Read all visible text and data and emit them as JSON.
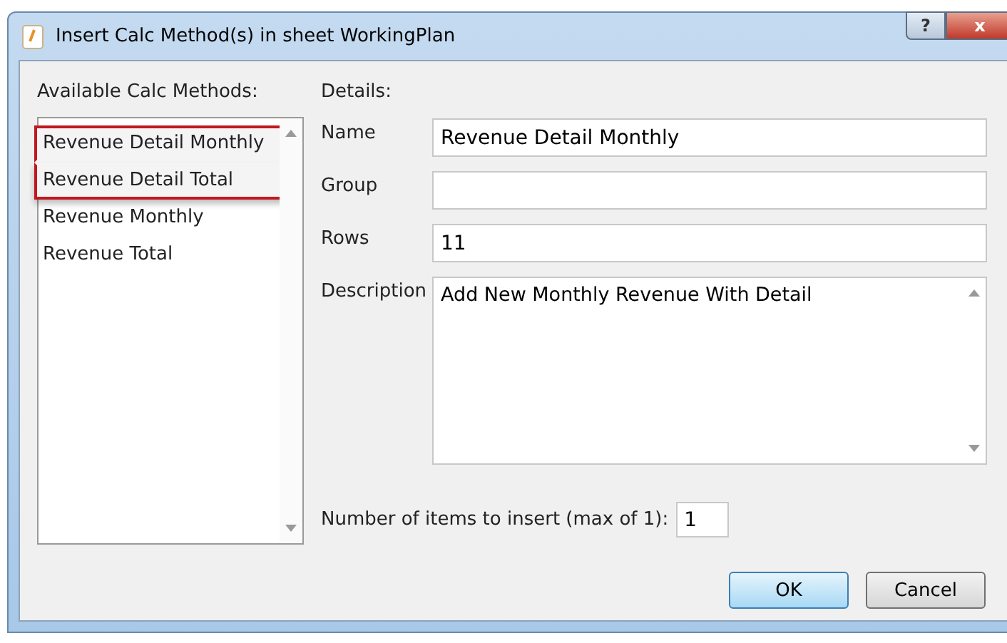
{
  "window": {
    "title": "Insert Calc Method(s) in sheet WorkingPlan",
    "buttons": [
      "?",
      "x"
    ]
  },
  "methods": {
    "label": "Available Calc Methods:",
    "items": [
      {
        "label": "Revenue Detail Monthly",
        "selected": true
      },
      {
        "label": "Revenue Detail Total",
        "selected": true
      },
      {
        "label": "Revenue Monthly",
        "selected": false
      },
      {
        "label": "Revenue Total",
        "selected": false
      }
    ]
  },
  "details": {
    "label": "Details:",
    "fields": [
      {
        "label": "Name",
        "value": "Revenue Detail Monthly",
        "kind": "line"
      },
      {
        "label": "Group",
        "kind": "line"
      },
      {
        "label": "Rows",
        "value": "11",
        "kind": "line"
      },
      {
        "label": "Description",
        "value": "Add New Monthly Revenue With Detail",
        "kind": "area"
      }
    ]
  },
  "count": {
    "label": "Number of items to insert (max of 1):",
    "value": "1"
  },
  "buttons": [
    {
      "label": "OK",
      "default": true
    },
    {
      "label": "Cancel",
      "default": false
    }
  ]
}
